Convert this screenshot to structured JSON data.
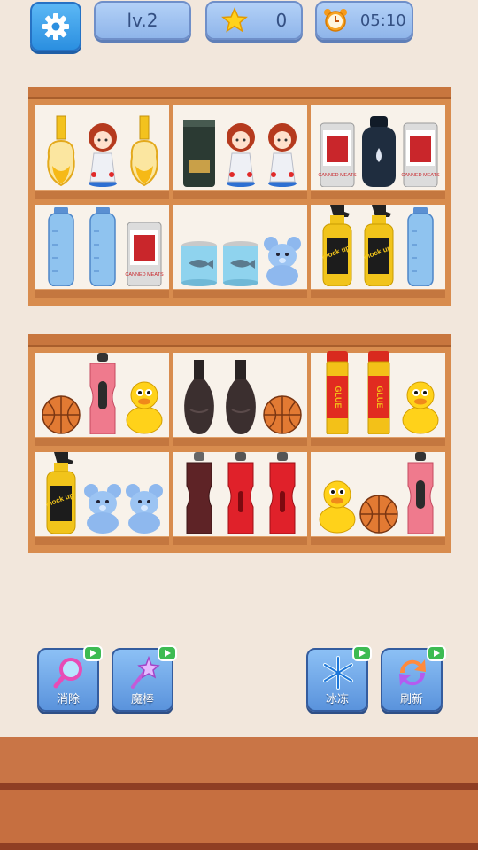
{
  "hud": {
    "level_label": "lv.2",
    "star_count": "0",
    "timer": "05:10",
    "settings_icon": "gear-icon",
    "star_icon": "star-icon",
    "timer_icon": "alarm-clock-icon"
  },
  "shelves": [
    {
      "name": "upper-shelf",
      "rows": [
        [
          [
            "perfume-bottle",
            "doll-figurine",
            "perfume-bottle"
          ],
          [
            "dark-can",
            "doll-figurine",
            "doll-figurine"
          ],
          [
            "canned-meat-can",
            "dark-lotion-bottle",
            "canned-meat-can"
          ]
        ],
        [
          [
            "water-bottle",
            "water-bottle",
            "canned-meat-can"
          ],
          [
            "fish-tin",
            "fish-tin",
            "blue-bear-toy"
          ],
          [
            "mockup-spray-bottle",
            "mockup-spray-bottle",
            "water-bottle"
          ]
        ]
      ]
    },
    {
      "name": "lower-shelf",
      "rows": [
        [
          [
            "basketball",
            "pink-sport-bottle",
            "yellow-duck"
          ],
          [
            "dark-vase",
            "dark-vase",
            "basketball"
          ],
          [
            "glue-stick",
            "glue-stick",
            "yellow-duck"
          ]
        ],
        [
          [
            "mockup-spray-bottle",
            "blue-bear-toy",
            "blue-bear-toy"
          ],
          [
            "dark-sport-bottle",
            "red-sport-bottle",
            "red-sport-bottle"
          ],
          [
            "yellow-duck",
            "basketball",
            "pink-sport-bottle"
          ]
        ]
      ]
    }
  ],
  "labels": {
    "canned_meat": "CANNED MEATS",
    "mockup": "mock up",
    "glue": "GLUE"
  },
  "powerups": [
    {
      "label": "消除",
      "icon": "magnifier-icon"
    },
    {
      "label": "魔棒",
      "icon": "magic-wand-icon"
    },
    {
      "label": "冰冻",
      "icon": "snowflake-icon"
    },
    {
      "label": "刷新",
      "icon": "refresh-icon"
    }
  ],
  "colors": {
    "shelf_wood": "#d88c4e",
    "button_blue": "#8fb5ea",
    "powerup_blue": "#5a93dc",
    "ad_badge_green": "#3dbb52",
    "background": "#f2e7dc"
  }
}
